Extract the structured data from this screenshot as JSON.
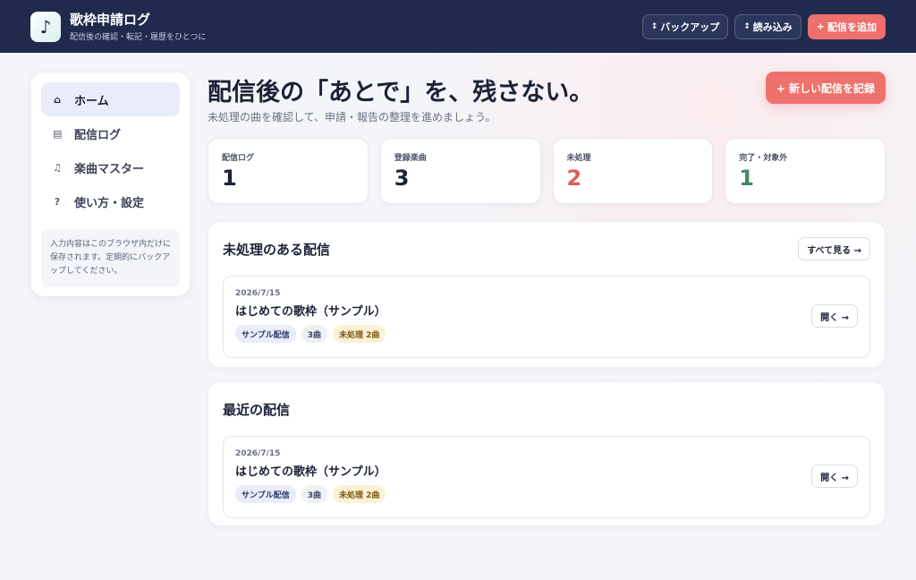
{
  "header": {
    "logo_glyph": "♪",
    "title": "歌枠申請ログ",
    "subtitle": "配信後の確認・転記・履歴をひとつに",
    "actions": [
      {
        "icon": "↕",
        "label": "バックアップ"
      },
      {
        "icon": "↕",
        "label": "読み込み"
      },
      {
        "icon": "+",
        "label": "配信を追加"
      }
    ]
  },
  "sidebar": {
    "items": [
      {
        "icon": "⌂",
        "label": "ホーム"
      },
      {
        "icon": "▤",
        "label": "配信ログ"
      },
      {
        "icon": "♫",
        "label": "楽曲マスター"
      },
      {
        "icon": "?",
        "label": "使い方・設定"
      }
    ],
    "note": "入力内容はこのブラウザ内だけに保存されます。定期的にバックアップしてください。"
  },
  "hero": {
    "title": "配信後の「あとで」を、残さない。",
    "subtitle": "未処理の曲を確認して、申請・報告の整理を進めましょう。",
    "button": "+ 新しい配信を記録"
  },
  "stats": [
    {
      "label": "配信ログ",
      "value": "1",
      "color": "#1b2236"
    },
    {
      "label": "登録楽曲",
      "value": "3",
      "color": "#1b2236"
    },
    {
      "label": "未処理",
      "value": "2",
      "color": "#dd5c58"
    },
    {
      "label": "完了・対象外",
      "value": "1",
      "color": "#3f8a62"
    }
  ],
  "pending": {
    "title": "未処理のある配信",
    "see_all": "すべて見る →",
    "card": {
      "date": "2026/7/15",
      "title": "はじめての歌枠（サンプル）",
      "tags": [
        "サンプル配信",
        "3曲",
        "未処理 2曲"
      ],
      "open": "開く →"
    }
  },
  "recent": {
    "title": "最近の配信",
    "card": {
      "date": "2026/7/15",
      "title": "はじめての歌枠（サンプル）",
      "tags": [
        "サンプル配信",
        "3曲",
        "未処理 2曲"
      ],
      "open": "開く →"
    }
  }
}
